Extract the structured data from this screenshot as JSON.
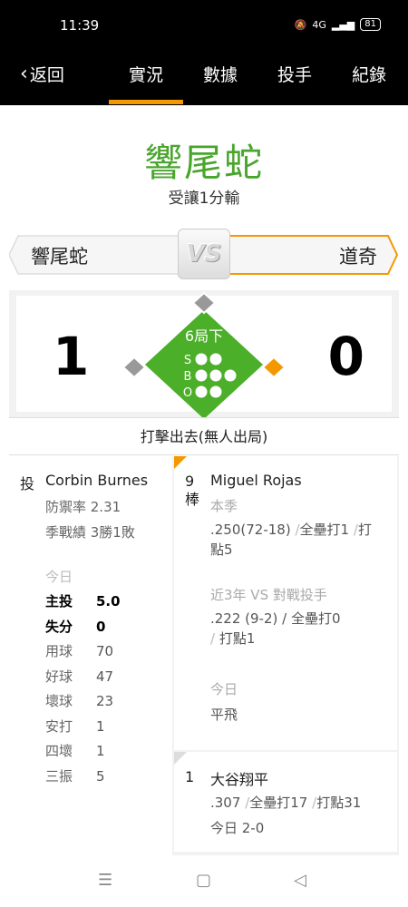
{
  "status": {
    "time": "11:39",
    "battery": "81",
    "net": "4G"
  },
  "nav": {
    "back_label": "返回",
    "tabs": [
      {
        "label": "實況",
        "active": true
      },
      {
        "label": "數據",
        "active": false
      },
      {
        "label": "投手",
        "active": false
      },
      {
        "label": "紀錄",
        "active": false
      }
    ]
  },
  "header": {
    "team_title": "響尾蛇",
    "result_sub": "受讓1分輸"
  },
  "matchup": {
    "home_team": "響尾蛇",
    "away_team": "道奇",
    "vs_label": "VS"
  },
  "score": {
    "home": "1",
    "away": "0",
    "inning": "6局下",
    "count": {
      "strikes": 0,
      "balls": 0,
      "outs": 0
    },
    "count_labels": {
      "s": "S",
      "b": "B",
      "o": "O"
    },
    "bases": {
      "first": true,
      "second": false,
      "third": false
    }
  },
  "play_result": "打擊出去(無人出局)",
  "pitcher": {
    "role_label": "投",
    "name": "Corbin Burnes",
    "era": "防禦率 2.31",
    "record": "季戰績 3勝1敗",
    "today_label": "今日",
    "stats": [
      {
        "label": "主投",
        "value": "5.0",
        "bold": true
      },
      {
        "label": "失分",
        "value": "0",
        "bold": true
      },
      {
        "label": "用球",
        "value": "70",
        "bold": false
      },
      {
        "label": "好球",
        "value": "47",
        "bold": false
      },
      {
        "label": "壞球",
        "value": "23",
        "bold": false
      },
      {
        "label": "安打",
        "value": "1",
        "bold": false
      },
      {
        "label": "四壞",
        "value": "1",
        "bold": false
      },
      {
        "label": "三振",
        "value": "5",
        "bold": false
      }
    ]
  },
  "batters": [
    {
      "order": "9",
      "order_suffix": "棒",
      "name": "Miguel Rojas",
      "season_label": "本季",
      "season_avg": ".250(72-18)",
      "season_hr": "全壘打1",
      "season_rbi_a": "打",
      "season_rbi_b": "點5",
      "vs_label": "近3年 VS 對戰投手",
      "vs_avg": ".222 (9-2)",
      "vs_hr": "全壘打0",
      "vs_rbi": "打點1",
      "today_label": "今日",
      "today_result": "平飛"
    },
    {
      "order": "1",
      "name": "大谷翔平",
      "season_avg": ".307",
      "season_hr": "全壘打17",
      "season_rbi": "打點31",
      "today": "今日 2-0"
    }
  ],
  "system_nav": {
    "menu": "☰",
    "home": "▢",
    "back": "◁"
  },
  "colors": {
    "accent": "#f39800",
    "team_green": "#4aa52e",
    "field_green": "#4caf2a"
  }
}
